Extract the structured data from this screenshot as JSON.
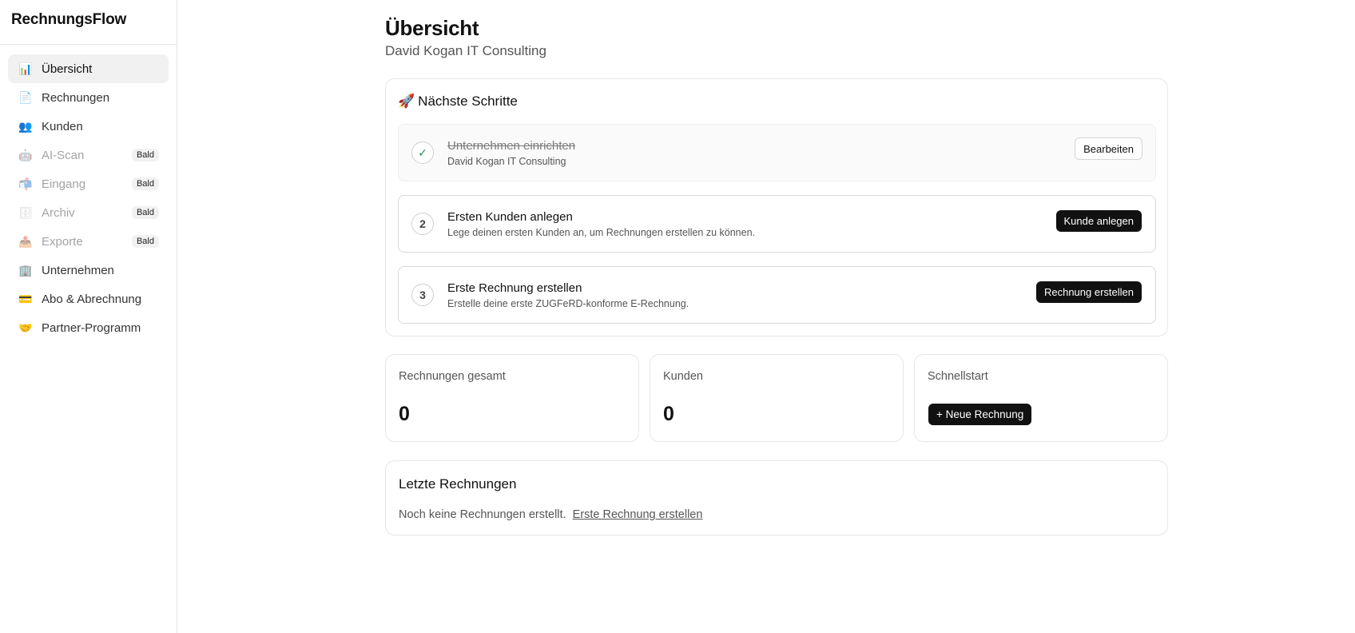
{
  "app": {
    "brand": "RechnungsFlow"
  },
  "sidebar": {
    "items": [
      {
        "label": "Übersicht",
        "icon": "📊",
        "badge": ""
      },
      {
        "label": "Rechnungen",
        "icon": "📄",
        "badge": ""
      },
      {
        "label": "Kunden",
        "icon": "👥",
        "badge": ""
      },
      {
        "label": "AI-Scan",
        "icon": "🤖",
        "badge": "Bald"
      },
      {
        "label": "Eingang",
        "icon": "📬",
        "badge": "Bald"
      },
      {
        "label": "Archiv",
        "icon": "🗄",
        "badge": "Bald"
      },
      {
        "label": "Exporte",
        "icon": "📤",
        "badge": "Bald"
      },
      {
        "label": "Unternehmen",
        "icon": "🏢",
        "badge": ""
      },
      {
        "label": "Abo & Abrechnung",
        "icon": "💳",
        "badge": ""
      },
      {
        "label": "Partner-Programm",
        "icon": "🤝",
        "badge": ""
      }
    ]
  },
  "header": {
    "title": "Übersicht",
    "subtitle": "David Kogan IT Consulting"
  },
  "steps": {
    "title": "Nächste Schritte",
    "icon": "🚀",
    "items": [
      {
        "marker": "✓",
        "title": "Unternehmen einrichten",
        "desc": "David Kogan IT Consulting",
        "button": "Bearbeiten"
      },
      {
        "marker": "2",
        "title": "Ersten Kunden anlegen",
        "desc": "Lege deinen ersten Kunden an, um Rechnungen erstellen zu können.",
        "button": "Kunde anlegen"
      },
      {
        "marker": "3",
        "title": "Erste Rechnung erstellen",
        "desc": "Erstelle deine erste ZUGFeRD-konforme E-Rechnung.",
        "button": "Rechnung erstellen"
      }
    ]
  },
  "stats": {
    "invoices": {
      "label": "Rechnungen gesamt",
      "value": "0"
    },
    "customers": {
      "label": "Kunden",
      "value": "0"
    },
    "quickstart": {
      "label": "Schnellstart",
      "button": "+ Neue Rechnung"
    }
  },
  "recent": {
    "title": "Letzte Rechnungen",
    "empty_text": "Noch keine Rechnungen erstellt.",
    "link": "Erste Rechnung erstellen"
  },
  "colors": {
    "accent": "#111111",
    "check": "#2e8b57",
    "muted": "#555555"
  }
}
